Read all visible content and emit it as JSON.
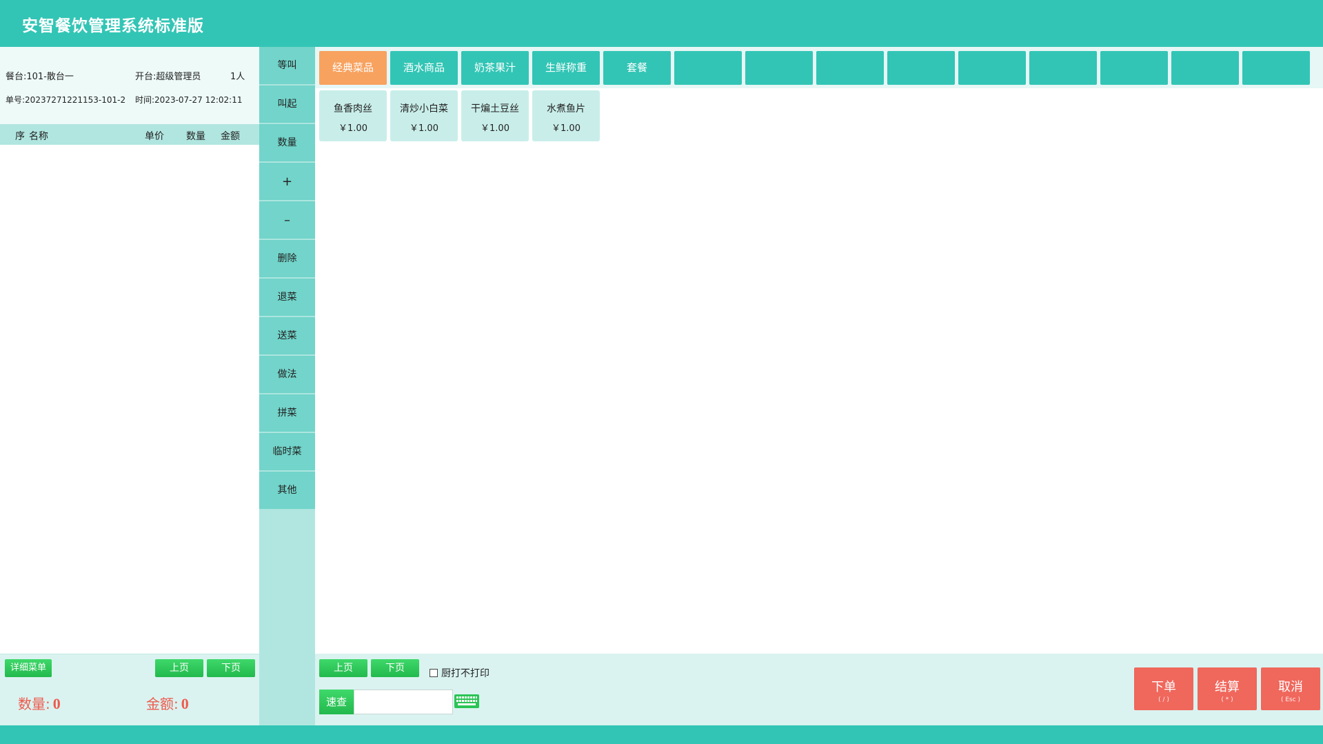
{
  "app": {
    "title": "安智餐饮管理系统标准版"
  },
  "info": {
    "table": "餐台:101-散台一",
    "opener": "开台:超级管理员",
    "guests": "1人",
    "order_no": "单号:20237271221153-101-2",
    "time": "时间:2023-07-27 12:02:11"
  },
  "order_header": {
    "seq": "序",
    "name": "名称",
    "price": "单价",
    "qty": "数量",
    "amount": "金额"
  },
  "left_footer": {
    "detail_btn": "详细菜单",
    "prev_btn": "上页",
    "next_btn": "下页",
    "qty_label": "数量:",
    "qty_value": "0",
    "amount_label": "金额:",
    "amount_value": "0"
  },
  "functions": [
    "等叫",
    "叫起",
    "数量",
    "+",
    "–",
    "删除",
    "退菜",
    "送菜",
    "做法",
    "拼菜",
    "临时菜",
    "其他"
  ],
  "categories": [
    "经典菜品",
    "酒水商品",
    "奶茶果汁",
    "生鲜称重",
    "套餐",
    "",
    "",
    "",
    "",
    "",
    "",
    "",
    "",
    ""
  ],
  "active_category": "经典菜品",
  "dishes": [
    {
      "name": "鱼香肉丝",
      "price": "￥1.00"
    },
    {
      "name": "清炒小白菜",
      "price": "￥1.00"
    },
    {
      "name": "干煸土豆丝",
      "price": "￥1.00"
    },
    {
      "name": "水煮鱼片",
      "price": "￥1.00"
    }
  ],
  "bottom": {
    "prev_btn": "上页",
    "next_btn": "下页",
    "no_print_label": "厨打不打印",
    "search_label": "速查",
    "search_value": ""
  },
  "actions": {
    "order": {
      "label": "下单",
      "key": "( / )"
    },
    "checkout": {
      "label": "结算",
      "key": "( * )"
    },
    "cancel": {
      "label": "取消",
      "key": "( Esc )"
    }
  },
  "colors": {
    "teal": "#32c5b5",
    "orange": "#f8a25f",
    "red": "#f0675c",
    "green": "#2bc455"
  }
}
